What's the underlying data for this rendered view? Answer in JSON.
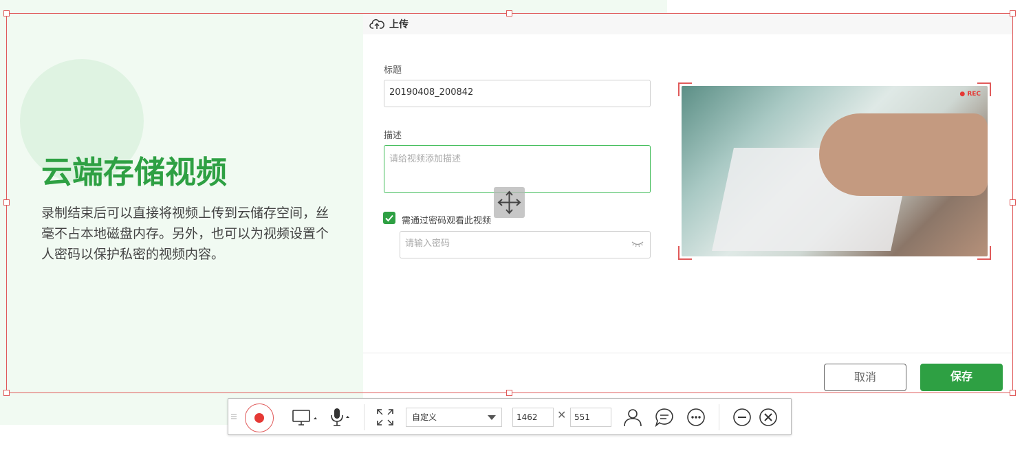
{
  "promo": {
    "title": "云端存储视频",
    "description": "录制结束后可以直接将视频上传到云储存空间，丝毫不占本地磁盘内存。另外，也可以为视频设置个人密码以保护私密的视频内容。"
  },
  "dialog": {
    "title": "上传",
    "title_label": "标题",
    "title_value": "20190408_200842",
    "desc_label": "描述",
    "desc_placeholder": "请给视频添加描述",
    "password_checkbox_label": "需通过密码观看此视频",
    "password_checked": true,
    "password_placeholder": "请输入密码",
    "cancel_label": "取消",
    "save_label": "保存",
    "preview_badge": "● REC"
  },
  "toolbar": {
    "region_mode": "自定义",
    "width": "1462",
    "height": "551",
    "times_sign": "✕",
    "icons": [
      "record-icon",
      "monitor-icon",
      "microphone-icon",
      "fullscreen-icon",
      "webcam-icon",
      "chat-icon",
      "more-icon",
      "minimize-icon",
      "close-icon"
    ]
  },
  "colors": {
    "accent": "#2ea043",
    "selection": "#e05a5a",
    "record": "#e53935"
  }
}
